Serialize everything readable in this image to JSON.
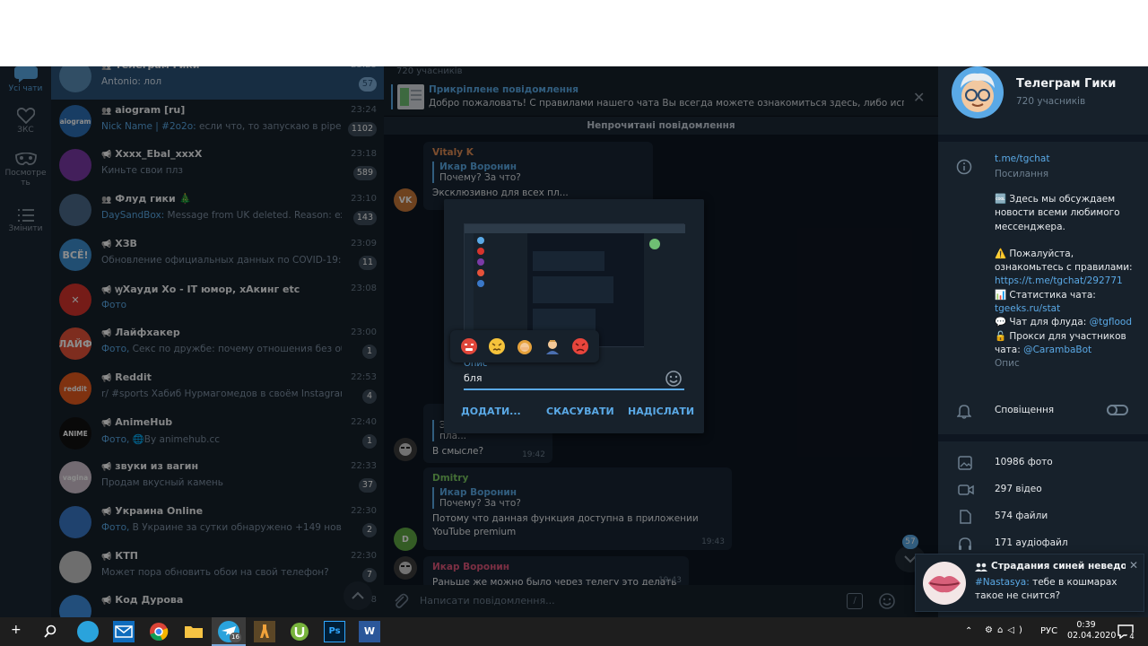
{
  "rail": {
    "items": [
      {
        "label": "Усі чати",
        "icon": "chat-bubble-icon",
        "active": true
      },
      {
        "label": "ЗКС",
        "icon": "heart-icon"
      },
      {
        "label": "Посмотре ть",
        "icon": "mask-icon"
      },
      {
        "label": "Змінити",
        "icon": "list-icon"
      }
    ]
  },
  "chats": [
    {
      "kind": "group",
      "name": "Телеграм Гики",
      "time": "23:23",
      "preview_sender": "",
      "preview": "Antonio: лол",
      "badge": "57",
      "active": true,
      "avatar_color": "#5a8fb8",
      "avatar_text": ""
    },
    {
      "kind": "group",
      "name": "aiogram [ru]",
      "time": "23:24",
      "preview_sender": "Nick Name | #2o2o:",
      "preview": " если что, то запускаю в pipenv sh...",
      "badge": "1102",
      "avatar_color": "#2c6fb6",
      "avatar_text": "aiogram"
    },
    {
      "kind": "channel",
      "name": "Xxxx_Ebal_xxxX",
      "time": "23:18",
      "preview_sender": "",
      "preview": "Киньте свои плз",
      "badge": "589",
      "avatar_color": "#7a3aa6",
      "avatar_text": ""
    },
    {
      "kind": "group",
      "name": "Флуд гики 🎄",
      "time": "23:10",
      "preview_sender": "DaySandBox:",
      "preview": " Message from UK deleted. Reason: external...",
      "badge": "143",
      "avatar_color": "#4b6b8a",
      "avatar_text": ""
    },
    {
      "kind": "channel",
      "name": "ХЗВ",
      "time": "23:09",
      "preview_sender": "",
      "preview": "Обновление официальных данных по COVID-19:  - Зара...",
      "badge": "11",
      "avatar_color": "#3c8fd0",
      "avatar_text": "ВСЁ!"
    },
    {
      "kind": "channel",
      "name": "ꝡХауди Хо - IT юмор, хАкинг etc",
      "time": "23:08",
      "preview_sender": "Фото",
      "preview": "",
      "badge": "",
      "avatar_color": "#d8342c",
      "avatar_text": "✕"
    },
    {
      "kind": "channel",
      "name": "Лайфхакер",
      "time": "23:00",
      "preview_sender": "Фото,",
      "preview": " Секс по дружбе: почему отношения без обязател...",
      "badge": "1",
      "avatar_color": "#e5523a",
      "avatar_text": "ЛАЙФ"
    },
    {
      "kind": "channel",
      "name": "Reddit",
      "time": "22:53",
      "preview_sender": "",
      "preview": "r/ #sports Хабиб Нурмагомедов в своём Instagram снов...",
      "badge": "4",
      "avatar_color": "#e85b1e",
      "avatar_text": "reddit"
    },
    {
      "kind": "channel",
      "name": "AnimeHub",
      "time": "22:40",
      "preview_sender": "Фото,",
      "preview": " 🌐By animehub.cc",
      "badge": "1",
      "avatar_color": "#111111",
      "avatar_text": "ANIME"
    },
    {
      "kind": "channel",
      "name": "звуки из вагин",
      "time": "22:33",
      "preview_sender": "",
      "preview": "Продам вкусный камень",
      "badge": "37",
      "avatar_color": "#d1c4cf",
      "avatar_text": "vagina"
    },
    {
      "kind": "channel",
      "name": "Украина Online",
      "time": "22:30",
      "preview_sender": "Фото,",
      "preview": " В Украине за сутки обнаружено +149 новых случа...",
      "badge": "2",
      "avatar_color": "#3a78c8",
      "avatar_text": ""
    },
    {
      "kind": "channel",
      "name": "КТП",
      "time": "22:30",
      "preview_sender": "",
      "preview": "Может пора обновить обои на свой телефон?",
      "badge": "7",
      "avatar_color": "#c9c9c9",
      "avatar_text": ""
    },
    {
      "kind": "channel",
      "name": "Код Дурова",
      "time": "22:28",
      "preview_sender": "",
      "preview": "",
      "badge": "",
      "avatar_color": "#3f8fe0",
      "avatar_text": ""
    }
  ],
  "chat": {
    "members_line": "720 учасників",
    "pinned_title": "Прикріплене повідомлення",
    "pinned_text": "Добро пожаловать! С правилами нашего чата Вы всегда можете ознакомиться здесь, либо используя ...",
    "unread_bar": "Непрочитані повідомлення",
    "messages": [
      {
        "author": "Vitaly K",
        "author_color": "#e08c54",
        "quote_name": "Икар Воронин",
        "quote_text": "Почему? За что?",
        "text": "Эксклюзивно для всех пл...",
        "time": "",
        "avatar_text": "VK",
        "avatar_color": "#c8783a"
      },
      {
        "author": "",
        "quote_name": "",
        "quote_text": "",
        "text": "Эксклюзивно для пла...",
        "text2": "В смысле?",
        "time": "19:42",
        "avatar_text": "",
        "avatar_color": "#3d3d3d"
      },
      {
        "author": "Dmitry",
        "author_color": "#7bc862",
        "quote_name": "Икар Воронин",
        "quote_text": "Почему? За что?",
        "text": "Потому что данная функция доступна в приложении YouTube premium",
        "time": "19:43",
        "avatar_text": "D",
        "avatar_color": "#5fa844"
      },
      {
        "author": "Икар Воронин",
        "author_color": "#e0577b",
        "text": "Раньше же можно было через телегу это делать",
        "time": "19:43",
        "avatar_color": "#3d3d3d"
      }
    ],
    "scroll_badge": "57",
    "composer_placeholder": "Написати повідомлення..."
  },
  "modal": {
    "caption_label": "Опис",
    "caption_value": "бля",
    "add_button": "ДОДАТИ...",
    "cancel_button": "СКАСУВАТИ",
    "send_button": "НАДІСЛАТИ",
    "emoji_suggestions": [
      "😡",
      "😠",
      "🤦",
      "🤦‍♂️",
      "😡"
    ]
  },
  "info": {
    "title": "Телеграм Гики",
    "members": "720 учасників",
    "link": "t.me/tgchat",
    "link_label": "Посилання",
    "desc_line1": "🆒 Здесь мы обсуждаем",
    "desc_line2": "новости всеми любимого",
    "desc_line3": "мессенджера.",
    "desc_line4": "⚠️ Пожалуйста,",
    "desc_line5": "ознакомьтесь с правилами:",
    "desc_rules_link": "https://t.me/tgchat/292771",
    "desc_line6": "📊 Статистика чата:",
    "desc_stat_link": "tgeeks.ru/stat",
    "desc_line7_a": "💬 Чат для флуда: ",
    "desc_flood_link": "@tgflood",
    "desc_line8": "🔓 Прокси для участников",
    "desc_line9_a": "чата: ",
    "desc_proxy_link": "@CarambaBot",
    "desc_label": "Опис",
    "notifications": "Сповіщення",
    "media": [
      {
        "label": "10986 фото",
        "icon": "photo-icon"
      },
      {
        "label": "297 відео",
        "icon": "video-icon"
      },
      {
        "label": "574 файли",
        "icon": "file-icon"
      },
      {
        "label": "171 аудіофайл",
        "icon": "headphones-icon"
      }
    ]
  },
  "toast": {
    "title": "Страдания синей неведом...",
    "sender": "#Nastasya:",
    "text1": " тебе в кошмарах",
    "text2": "такое не снится?"
  },
  "taskbar": {
    "lang": "РУС",
    "time": "0:39",
    "date": "02.04.2020",
    "telegram_badge": "16",
    "notif_count": "4"
  }
}
